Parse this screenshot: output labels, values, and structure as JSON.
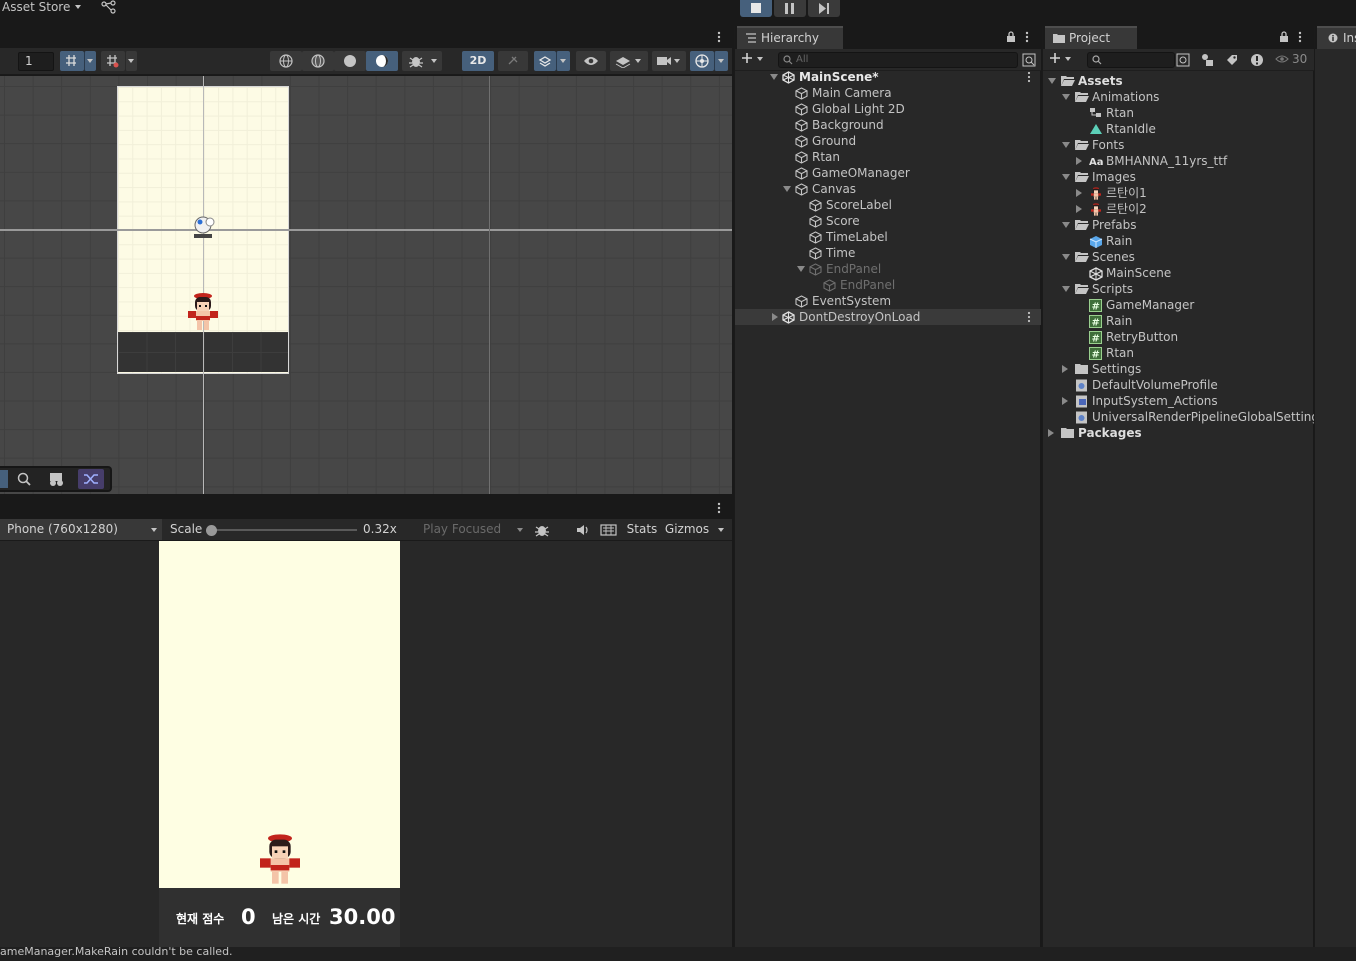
{
  "topbar": {
    "asset_store": "Asset Store",
    "colors": {
      "play_active": "#46607c"
    }
  },
  "scene": {
    "toolbar": {
      "layer_value": "1",
      "mode_2d": "2D"
    }
  },
  "game": {
    "toolbar": {
      "resolution": "Phone (760x1280)",
      "scale_label": "Scale",
      "scale_value": "0.32x",
      "play_mode": "Play Focused",
      "stats": "Stats",
      "gizmos": "Gizmos"
    },
    "hud": {
      "score_label": "현재 점수",
      "score_value": "0",
      "time_label": "남은 시간",
      "time_value": "30.00"
    }
  },
  "hierarchy": {
    "tab": "Hierarchy",
    "search_placeholder": "All",
    "scene_name": "MainScene*",
    "items": [
      {
        "label": "Main Camera",
        "icon": "gameobject-icon"
      },
      {
        "label": "Global Light 2D",
        "icon": "gameobject-icon"
      },
      {
        "label": "Background",
        "icon": "gameobject-icon"
      },
      {
        "label": "Ground",
        "icon": "gameobject-icon"
      },
      {
        "label": "Rtan",
        "icon": "gameobject-icon"
      },
      {
        "label": "GameOManager",
        "icon": "gameobject-icon"
      },
      {
        "label": "Canvas",
        "icon": "gameobject-icon"
      },
      {
        "label": "ScoreLabel",
        "icon": "gameobject-icon"
      },
      {
        "label": "Score",
        "icon": "gameobject-icon"
      },
      {
        "label": "TimeLabel",
        "icon": "gameobject-icon"
      },
      {
        "label": "Time",
        "icon": "gameobject-icon"
      },
      {
        "label": "EndPanel",
        "icon": "gameobject-icon"
      },
      {
        "label": "EndPanel",
        "icon": "gameobject-icon"
      },
      {
        "label": "EventSystem",
        "icon": "gameobject-icon"
      }
    ],
    "dont_destroy": "DontDestroyOnLoad"
  },
  "project": {
    "tab": "Project",
    "hidden_count": "30",
    "tree": [
      {
        "label": "Assets",
        "icon": "folder-open-icon"
      },
      {
        "label": "Animations",
        "icon": "folder-open-icon"
      },
      {
        "label": "Rtan",
        "icon": "animator-icon"
      },
      {
        "label": "RtanIdle",
        "icon": "animation-clip-icon"
      },
      {
        "label": "Fonts",
        "icon": "folder-open-icon"
      },
      {
        "label": "BMHANNA_11yrs_ttf",
        "icon": "font-icon"
      },
      {
        "label": "Images",
        "icon": "folder-open-icon"
      },
      {
        "label": "르탄이1",
        "icon": "sprite-icon"
      },
      {
        "label": "르탄이2",
        "icon": "sprite-icon"
      },
      {
        "label": "Prefabs",
        "icon": "folder-open-icon"
      },
      {
        "label": "Rain",
        "icon": "prefab-icon"
      },
      {
        "label": "Scenes",
        "icon": "folder-open-icon"
      },
      {
        "label": "MainScene",
        "icon": "scene-icon"
      },
      {
        "label": "Scripts",
        "icon": "folder-open-icon"
      },
      {
        "label": "GameManager",
        "icon": "script-icon"
      },
      {
        "label": "Rain",
        "icon": "script-icon"
      },
      {
        "label": "RetryButton",
        "icon": "script-icon"
      },
      {
        "label": "Rtan",
        "icon": "script-icon"
      },
      {
        "label": "Settings",
        "icon": "folder-icon"
      },
      {
        "label": "DefaultVolumeProfile",
        "icon": "asset-icon"
      },
      {
        "label": "InputSystem_Actions",
        "icon": "input-actions-icon"
      },
      {
        "label": "UniversalRenderPipelineGlobalSettings",
        "icon": "asset-icon"
      },
      {
        "label": "Packages",
        "icon": "folder-icon"
      }
    ]
  },
  "inspector": {
    "tab": "Ins"
  },
  "status": {
    "message": "ameManager.MakeRain couldn't be called."
  }
}
